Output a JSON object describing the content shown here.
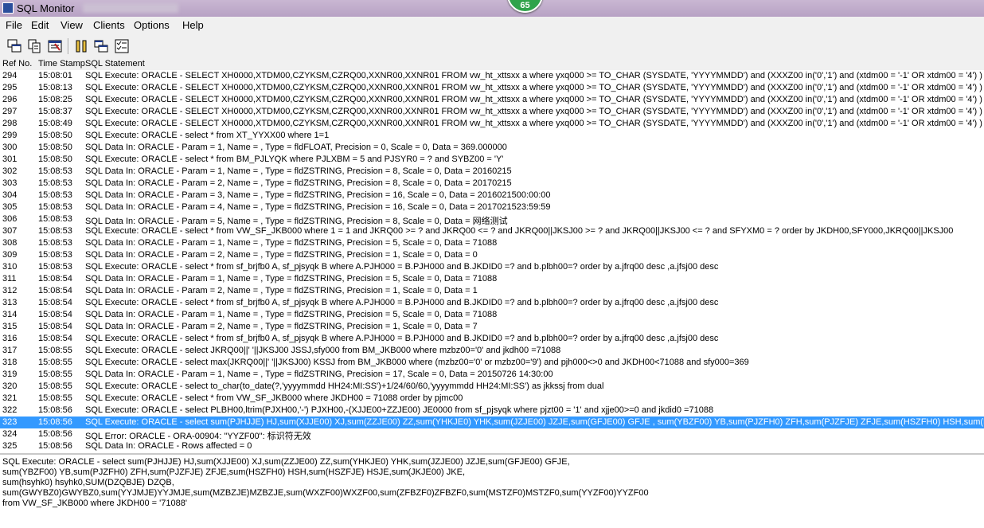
{
  "window": {
    "title": "SQL Monitor",
    "badge": "65"
  },
  "menu": [
    "File",
    "Edit",
    "View",
    "Clients",
    "Options",
    "Help"
  ],
  "toolbar": [
    "copy-window-icon",
    "copy-icon",
    "clear-log-icon",
    "pause-icon",
    "tile-windows-icon",
    "checklist-icon"
  ],
  "columns": {
    "ref": "Ref No.",
    "time": "Time Stamp",
    "sql": "SQL Statement"
  },
  "rows": [
    {
      "ref": "294",
      "time": "15:08:01",
      "sql": "SQL Execute: ORACLE - SELECT XH0000,XTDM00,CZYKSM,CZRQ00,XXNR00,XXNR01 FROM vw_ht_xttsxx a where yxq000 >= TO_CHAR (SYSDATE, 'YYYYMMDD') and (XXXZ00 in('0','1') and (xtdm00 = '-1' OR xtdm00 = '4') ) and (JSI"
    },
    {
      "ref": "295",
      "time": "15:08:13",
      "sql": "SQL Execute: ORACLE - SELECT XH0000,XTDM00,CZYKSM,CZRQ00,XXNR00,XXNR01 FROM vw_ht_xttsxx a where yxq000 >= TO_CHAR (SYSDATE, 'YYYYMMDD') and (XXXZ00 in('0','1') and (xtdm00 = '-1' OR xtdm00 = '4') ) and (JSI"
    },
    {
      "ref": "296",
      "time": "15:08:25",
      "sql": "SQL Execute: ORACLE - SELECT XH0000,XTDM00,CZYKSM,CZRQ00,XXNR00,XXNR01 FROM vw_ht_xttsxx a where yxq000 >= TO_CHAR (SYSDATE, 'YYYYMMDD') and (XXXZ00 in('0','1') and (xtdm00 = '-1' OR xtdm00 = '4') ) and (JSI"
    },
    {
      "ref": "297",
      "time": "15:08:37",
      "sql": "SQL Execute: ORACLE - SELECT XH0000,XTDM00,CZYKSM,CZRQ00,XXNR00,XXNR01 FROM vw_ht_xttsxx a where yxq000 >= TO_CHAR (SYSDATE, 'YYYYMMDD') and (XXXZ00 in('0','1') and (xtdm00 = '-1' OR xtdm00 = '4') ) and (JSI"
    },
    {
      "ref": "298",
      "time": "15:08:49",
      "sql": "SQL Execute: ORACLE - SELECT XH0000,XTDM00,CZYKSM,CZRQ00,XXNR00,XXNR01 FROM vw_ht_xttsxx a where yxq000 >= TO_CHAR (SYSDATE, 'YYYYMMDD') and (XXXZ00 in('0','1') and (xtdm00 = '-1' OR xtdm00 = '4') ) and (JSI"
    },
    {
      "ref": "299",
      "time": "15:08:50",
      "sql": "SQL Execute: ORACLE - select * from XT_YYXX00 where 1=1"
    },
    {
      "ref": "300",
      "time": "15:08:50",
      "sql": "SQL Data In: ORACLE - Param = 1, Name = , Type = fldFLOAT, Precision = 0, Scale = 0, Data = 369.000000"
    },
    {
      "ref": "301",
      "time": "15:08:50",
      "sql": "SQL Execute: ORACLE - select * from BM_PJLYQK where PJLXBM = 5 and PJSYR0 = ? and SYBZ00 = 'Y'"
    },
    {
      "ref": "302",
      "time": "15:08:53",
      "sql": "SQL Data In: ORACLE - Param = 1, Name = , Type = fldZSTRING, Precision = 8, Scale = 0, Data = 20160215"
    },
    {
      "ref": "303",
      "time": "15:08:53",
      "sql": "SQL Data In: ORACLE - Param = 2, Name = , Type = fldZSTRING, Precision = 8, Scale = 0, Data = 20170215"
    },
    {
      "ref": "304",
      "time": "15:08:53",
      "sql": "SQL Data In: ORACLE - Param = 3, Name = , Type = fldZSTRING, Precision = 16, Scale = 0, Data = 2016021500:00:00"
    },
    {
      "ref": "305",
      "time": "15:08:53",
      "sql": "SQL Data In: ORACLE - Param = 4, Name = , Type = fldZSTRING, Precision = 16, Scale = 0, Data = 2017021523:59:59"
    },
    {
      "ref": "306",
      "time": "15:08:53",
      "sql": "SQL Data In: ORACLE - Param = 5, Name = , Type = fldZSTRING, Precision = 8, Scale = 0, Data = 网络测试"
    },
    {
      "ref": "307",
      "time": "15:08:53",
      "sql": "SQL Execute: ORACLE - select * from VW_SF_JKB000 where 1 = 1 and JKRQ00 >= ? and JKRQ00 <= ? and JKRQ00||JKSJ00 >= ? and JKRQ00||JKSJ00 <= ? and SFYXM0 = ? order by JKDH00,SFY000,JKRQ00||JKSJ00"
    },
    {
      "ref": "308",
      "time": "15:08:53",
      "sql": "SQL Data In: ORACLE - Param = 1, Name = , Type = fldZSTRING, Precision = 5, Scale = 0, Data = 71088"
    },
    {
      "ref": "309",
      "time": "15:08:53",
      "sql": "SQL Data In: ORACLE - Param = 2, Name = , Type = fldZSTRING, Precision = 1, Scale = 0, Data = 0"
    },
    {
      "ref": "310",
      "time": "15:08:53",
      "sql": "SQL Execute: ORACLE - select * from sf_brjfb0 A, sf_pjsyqk B where A.PJH000 = B.PJH000 and B.JKDID0 =? and b.plbh00=? order by a.jfrq00 desc ,a.jfsj00 desc"
    },
    {
      "ref": "311",
      "time": "15:08:54",
      "sql": "SQL Data In: ORACLE - Param = 1, Name = , Type = fldZSTRING, Precision = 5, Scale = 0, Data = 71088"
    },
    {
      "ref": "312",
      "time": "15:08:54",
      "sql": "SQL Data In: ORACLE - Param = 2, Name = , Type = fldZSTRING, Precision = 1, Scale = 0, Data = 1"
    },
    {
      "ref": "313",
      "time": "15:08:54",
      "sql": "SQL Execute: ORACLE - select * from sf_brjfb0 A, sf_pjsyqk B where A.PJH000 = B.PJH000 and B.JKDID0 =? and b.plbh00=? order by a.jfrq00 desc ,a.jfsj00 desc"
    },
    {
      "ref": "314",
      "time": "15:08:54",
      "sql": "SQL Data In: ORACLE - Param = 1, Name = , Type = fldZSTRING, Precision = 5, Scale = 0, Data = 71088"
    },
    {
      "ref": "315",
      "time": "15:08:54",
      "sql": "SQL Data In: ORACLE - Param = 2, Name = , Type = fldZSTRING, Precision = 1, Scale = 0, Data = 7"
    },
    {
      "ref": "316",
      "time": "15:08:54",
      "sql": "SQL Execute: ORACLE - select * from sf_brjfb0 A, sf_pjsyqk B where A.PJH000 = B.PJH000 and B.JKDID0 =? and b.plbh00=? order by a.jfrq00 desc ,a.jfsj00 desc"
    },
    {
      "ref": "317",
      "time": "15:08:55",
      "sql": "SQL Execute: ORACLE - select JKRQ00||' '||JKSJ00 JSSJ,sfy000 from BM_JKB000 where mzbz00='0' and jkdh00 =71088"
    },
    {
      "ref": "318",
      "time": "15:08:55",
      "sql": "SQL Execute: ORACLE - select max(JKRQ00||' '||JKSJ00) KSSJ from BM_JKB000 where (mzbz00='0' or mzbz00='9') and pjh000<>0 and JKDH00<71088 and sfy000=369"
    },
    {
      "ref": "319",
      "time": "15:08:55",
      "sql": "SQL Data In: ORACLE - Param = 1, Name = , Type = fldZSTRING, Precision = 17, Scale = 0, Data = 20150726 14:30:00"
    },
    {
      "ref": "320",
      "time": "15:08:55",
      "sql": "SQL Execute: ORACLE - select to_char(to_date(?,'yyyymmdd HH24:MI:SS')+1/24/60/60,'yyyymmdd HH24:MI:SS') as jkkssj from dual"
    },
    {
      "ref": "321",
      "time": "15:08:55",
      "sql": "SQL Execute: ORACLE - select * from VW_SF_JKB000 where JKDH00 = 71088 order by pjmc00"
    },
    {
      "ref": "322",
      "time": "15:08:56",
      "sql": "SQL Execute: ORACLE - select PLBH00,ltrim(PJXH00,'-') PJXH00,-(XJJE00+ZZJE00) JE0000 from sf_pjsyqk where pjzt00 = '1' and xjje00>=0 and jkdid0 =71088"
    },
    {
      "ref": "323",
      "time": "15:08:56",
      "sql": "SQL Execute: ORACLE - select sum(PJHJJE) HJ,sum(XJJE00) XJ,sum(ZZJE00) ZZ,sum(YHKJE0) YHK,sum(JZJE00) JZJE,sum(GFJE00) GFJE , sum(YBZF00) YB,sum(PJZFH0) ZFH,sum(PJZFJE) ZFJE,sum(HSZFH0) HSH,sum(HSZFJE) HS"
    },
    {
      "ref": "324",
      "time": "15:08:56",
      "sql": "SQL Error: ORACLE - ORA-00904: \"YYZF00\": 标识符无效"
    },
    {
      "ref": "325",
      "time": "15:08:56",
      "sql": "SQL Data In: ORACLE - Rows affected = 0"
    }
  ],
  "selected_ref": "323",
  "detail": [
    "SQL Execute: ORACLE - select sum(PJHJJE) HJ,sum(XJJE00) XJ,sum(ZZJE00) ZZ,sum(YHKJE0) YHK,sum(JZJE00) JZJE,sum(GFJE00) GFJE,",
    " sum(YBZF00) YB,sum(PJZFH0) ZFH,sum(PJZFJE) ZFJE,sum(HSZFH0) HSH,sum(HSZFJE) HSJE,sum(JKJE00) JKE,",
    " sum(hsyhk0) hsyhk0,SUM(DZQBJE) DZQB,",
    "sum(GWYBZ0)GWYBZ0,sum(YYJMJE)YYJMJE,sum(MZBZJE)MZBZJE,sum(WXZF00)WXZF00,sum(ZFBZF0)ZFBZF0,sum(MSTZF0)MSTZF0,sum(YYZF00)YYZF00",
    " from VW_SF_JKB000  where JKDH00 = '71088'"
  ]
}
